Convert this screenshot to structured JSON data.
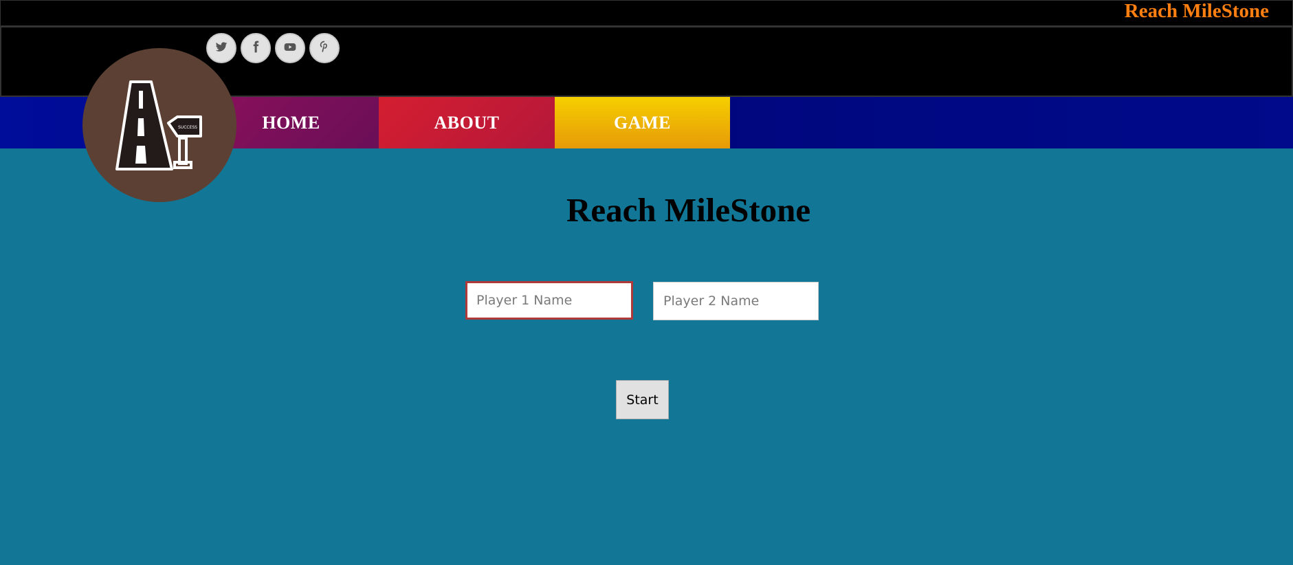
{
  "site_title": "Reach MileStone",
  "social": [
    {
      "name": "twitter",
      "icon": "twitter-icon"
    },
    {
      "name": "facebook",
      "icon": "facebook-icon"
    },
    {
      "name": "youtube",
      "icon": "youtube-icon"
    },
    {
      "name": "pinterest",
      "icon": "pinterest-icon"
    }
  ],
  "logo": {
    "sign_text": "SUCCESS",
    "icon": "road-milestone-icon"
  },
  "nav": {
    "home_label": "HOME",
    "about_label": "ABOUT",
    "game_label": "GAME"
  },
  "main": {
    "title": "Reach MileStone",
    "player1_placeholder": "Player 1 Name",
    "player2_placeholder": "Player 2 Name",
    "player1_value": "",
    "player2_value": "",
    "start_label": "Start"
  },
  "colors": {
    "page_bg": "#127797",
    "site_title": "#ff7f11",
    "nav_bg": "#000a8a",
    "home_bg": "#7a0f5a",
    "about_bg": "#c81b34",
    "game_bg": "#f0b800",
    "logo_bg": "#5c4033"
  }
}
